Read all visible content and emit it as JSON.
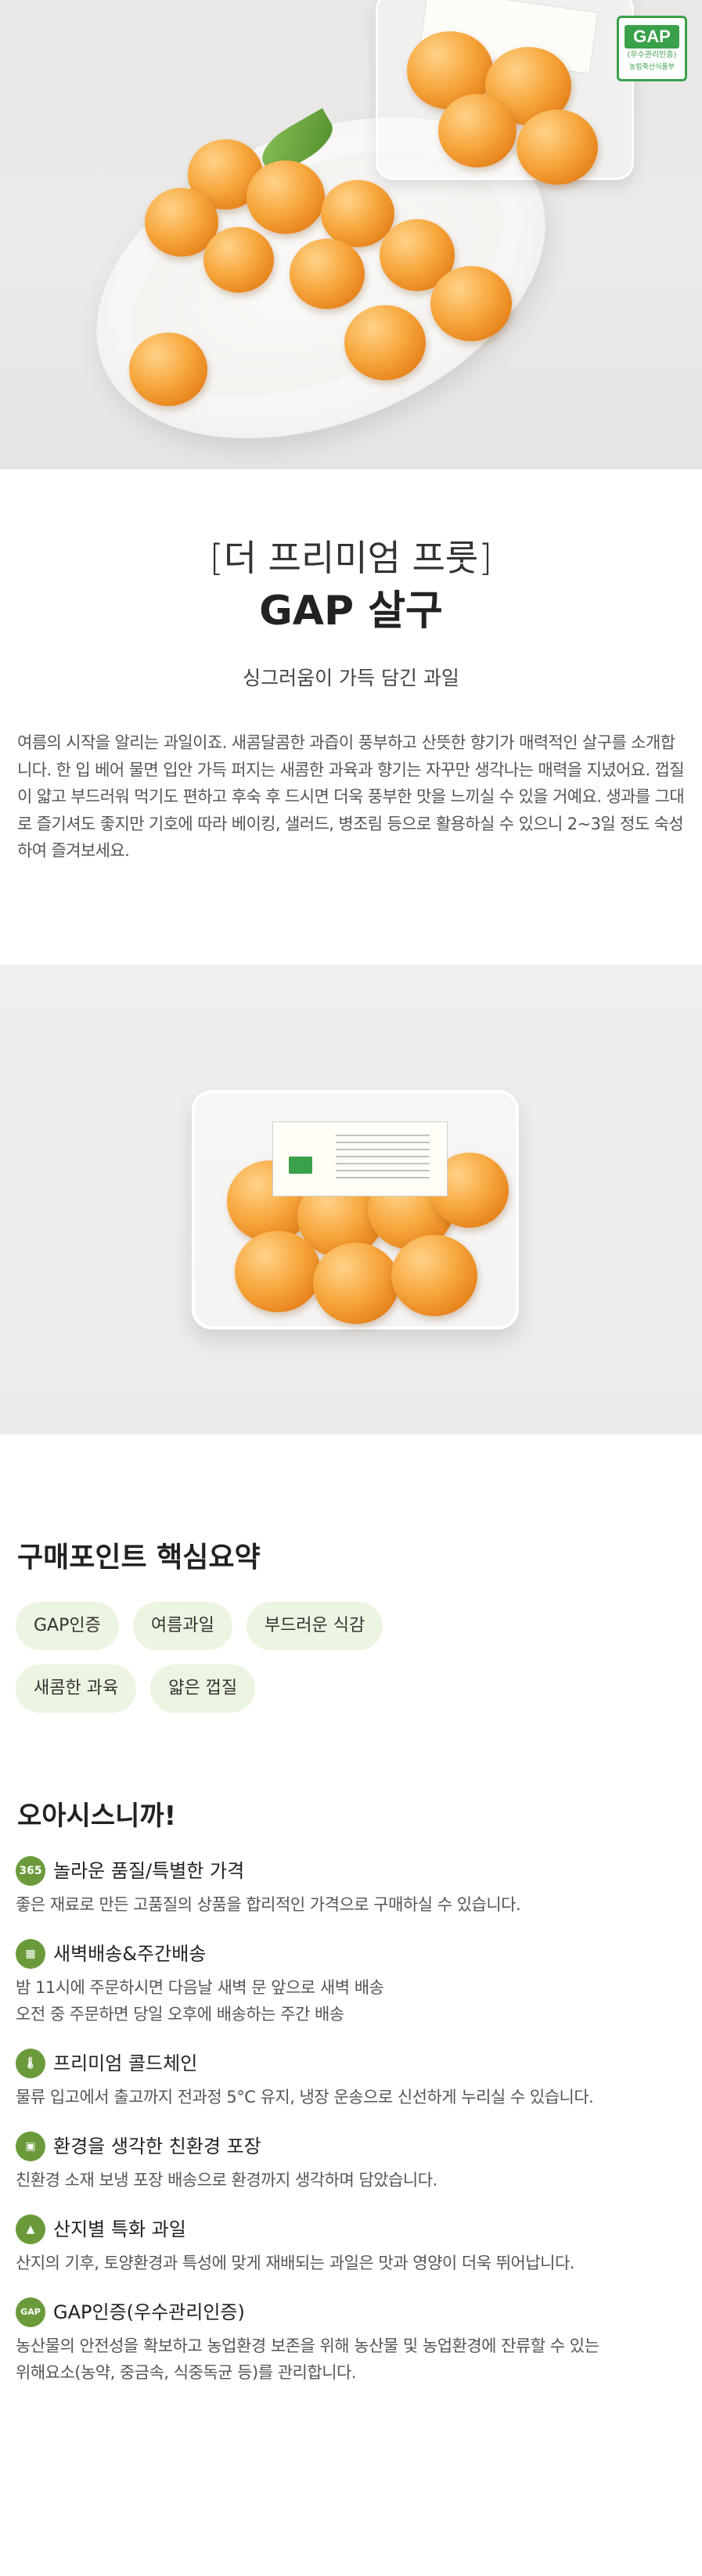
{
  "hero": {
    "gap_logo": {
      "mark": "GAP",
      "sub": "(우수관리인증)",
      "foot": "농림축산식품부"
    }
  },
  "product": {
    "bracket_title": "[더 프리미엄 프룻]",
    "name": "GAP 살구",
    "subtitle": "싱그러움이 가득 담긴 과일",
    "description": "여름의 시작을 알리는 과일이죠. 새콤달콤한 과즙이 풍부하고 산뜻한 향기가 매력적인 살구를 소개합니다. 한 입 베어 물면 입안 가득 퍼지는 새콤한 과육과 향기는 자꾸만 생각나는 매력을 지녔어요. 껍질이 얇고 부드러워 먹기도 편하고 후숙 후 드시면 더욱 풍부한 맛을 느끼실 수 있을 거예요. 생과를 그대로 즐기셔도 좋지만 기호에 따라 베이킹, 샐러드, 병조림 등으로 활용하실 수 있으니 2~3일 정도 숙성하여 즐겨보세요."
  },
  "summary": {
    "title": "구매포인트 핵심요약",
    "tags": [
      "GAP인증",
      "여름과일",
      "부드러운 식감",
      "새콤한 과육",
      "얇은 껍질"
    ]
  },
  "features": {
    "title": "오아시스니까!",
    "items": [
      {
        "icon": "365",
        "icon_name": "price-365-icon",
        "title": "놀라운 품질/특별한 가격",
        "lines": [
          "좋은 재료로 만든 고품질의 상품을  합리적인 가격으로 구매하실 수 있습니다."
        ]
      },
      {
        "icon": "▦",
        "icon_name": "delivery-calendar-icon",
        "title": "새벽배송&주간배송",
        "lines": [
          "밤 11시에 주문하시면 다음날 새벽 문 앞으로 새벽 배송",
          "오전 중 주문하면 당일 오후에 배송하는 주간 배송"
        ]
      },
      {
        "icon": "🌡",
        "icon_name": "thermometer-icon",
        "title": "프리미엄 콜드체인",
        "lines": [
          "물류 입고에서 출고까지 전과정 5°C 유지, 냉장 운송으로 신선하게 누리실 수 있습니다."
        ]
      },
      {
        "icon": "▣",
        "icon_name": "eco-package-icon",
        "title": "환경을 생각한 친환경 포장",
        "lines": [
          "친환경 소재 보냉 포장 배송으로 환경까지 생각하며 담았습니다."
        ]
      },
      {
        "icon": "▲",
        "icon_name": "mountain-icon",
        "title": "산지별 특화 과일",
        "lines": [
          "산지의 기후, 토양환경과 특성에 맞게 재배되는 과일은 맛과 영양이 더욱 뛰어납니다."
        ]
      },
      {
        "icon": "GAP",
        "icon_name": "gap-cert-icon",
        "title": "GAP인증(우수관리인증)",
        "lines": [
          "농산물의 안전성을 확보하고 농업환경 보존을 위해 농산물 및 농업환경에 잔류할 수 있는",
          "위해요소(농약, 중금속, 식중독균 등)를 관리합니다."
        ]
      }
    ]
  },
  "colors": {
    "accent_green": "#6a9a3a",
    "tag_background": "#ecf5e1",
    "gap_green": "#3aa14a",
    "apricot_orange": "#f7a73c"
  }
}
